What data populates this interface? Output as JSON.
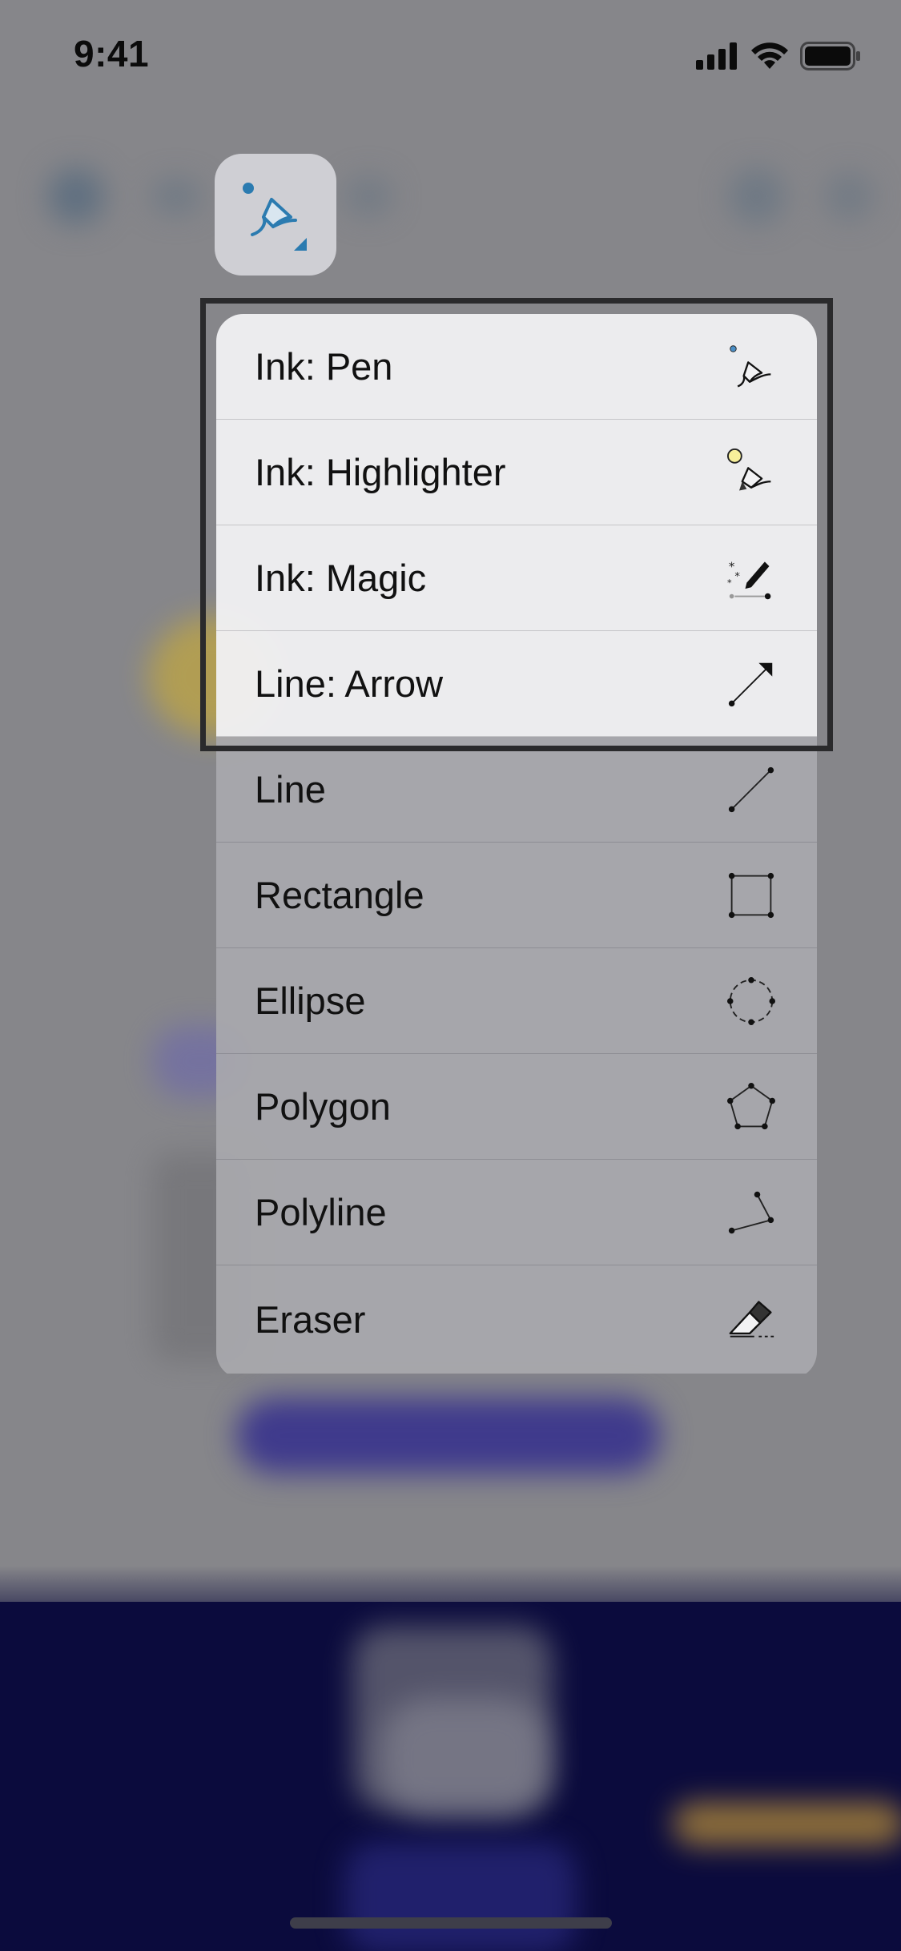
{
  "status_bar": {
    "time": "9:41"
  },
  "tool_button": {
    "icon": "pen-tool-icon",
    "accent": "#2b7bb0"
  },
  "menu": {
    "items": [
      {
        "label": "Ink: Pen",
        "icon": "ink-pen-icon"
      },
      {
        "label": "Ink: Highlighter",
        "icon": "ink-highlighter-icon"
      },
      {
        "label": "Ink: Magic",
        "icon": "ink-magic-icon"
      },
      {
        "label": "Line: Arrow",
        "icon": "line-arrow-icon"
      },
      {
        "label": "Line",
        "icon": "line-icon"
      },
      {
        "label": "Rectangle",
        "icon": "rectangle-icon"
      },
      {
        "label": "Ellipse",
        "icon": "ellipse-icon"
      },
      {
        "label": "Polygon",
        "icon": "polygon-icon"
      },
      {
        "label": "Polyline",
        "icon": "polyline-icon"
      },
      {
        "label": "Eraser",
        "icon": "eraser-icon"
      }
    ]
  },
  "colors": {
    "highlighter_dot": "#f7ef9a",
    "pen_dot": "#4a8ec6",
    "background_navy": "#0b0b3d",
    "background_purple": "#3f3a8c"
  }
}
